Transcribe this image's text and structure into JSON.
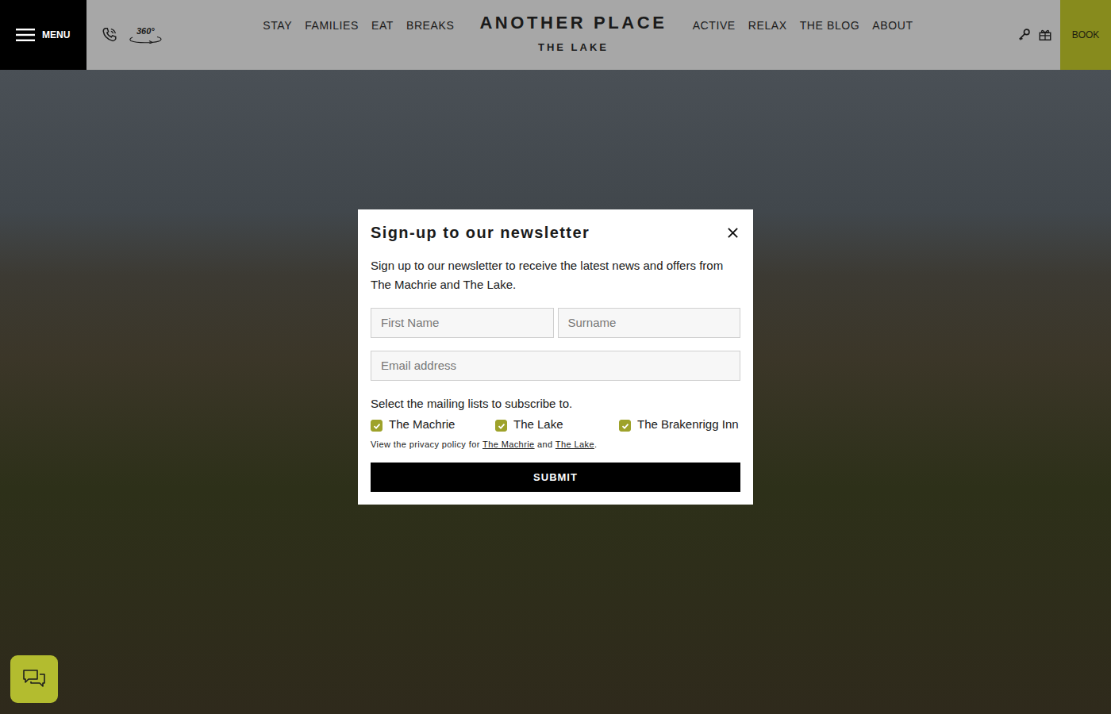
{
  "header": {
    "menu_label": "MENU",
    "tour_label": "360°",
    "nav_left": [
      "STAY",
      "FAMILIES",
      "EAT",
      "BREAKS"
    ],
    "logo_title": "ANOTHER PLACE",
    "logo_subtitle": "THE LAKE",
    "nav_right": [
      "ACTIVE",
      "RELAX",
      "THE BLOG",
      "ABOUT"
    ],
    "book_label": "BOOK"
  },
  "modal": {
    "title": "Sign-up to our newsletter",
    "intro": "Sign up to our newsletter to receive the latest news and offers from The Machrie and The Lake.",
    "name_fields": [
      {
        "placeholder": "First Name"
      },
      {
        "placeholder": "Surname"
      }
    ],
    "email_field": {
      "placeholder": "Email address"
    },
    "lists_label": "Select the mailing lists to subscribe to.",
    "lists": [
      {
        "label": "The Machrie",
        "checked": true
      },
      {
        "label": "The Lake",
        "checked": true
      },
      {
        "label": "The Brakenrigg Inn",
        "checked": true
      }
    ],
    "privacy": {
      "prefix": "View the privacy policy for",
      "links": [
        "The Machrie",
        "The Lake"
      ],
      "joiner": "and",
      "suffix": "."
    },
    "submit": "SUBMIT"
  }
}
